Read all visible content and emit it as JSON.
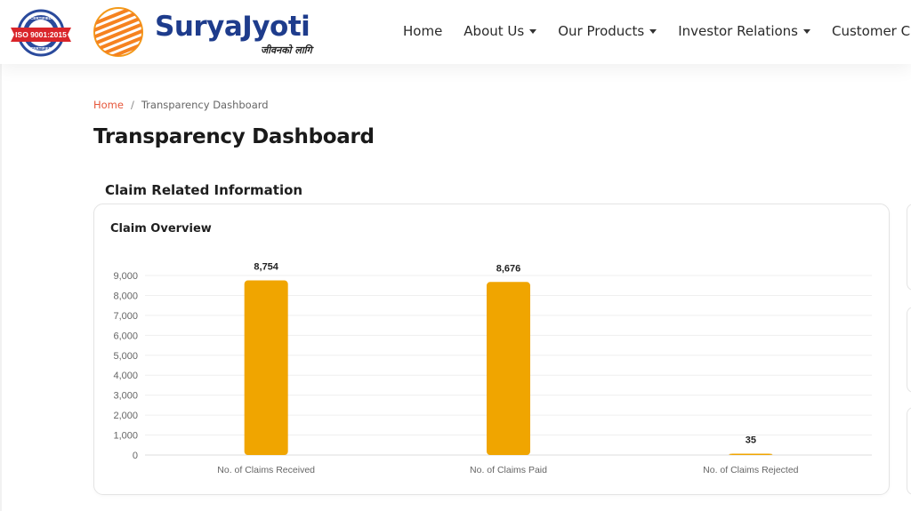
{
  "header": {
    "iso_badge": {
      "top_text": "CERTIFIED",
      "main_text": "ISO 9001:2015",
      "bottom_text": "CERTIFIED"
    },
    "brand_name": "SuryaJyoti",
    "tagline": "जीवनको लागि",
    "nav": [
      {
        "label": "Home",
        "has_dropdown": false
      },
      {
        "label": "About Us",
        "has_dropdown": true
      },
      {
        "label": "Our Products",
        "has_dropdown": true
      },
      {
        "label": "Investor Relations",
        "has_dropdown": true
      },
      {
        "label": "Customer Care",
        "has_dropdown": false
      }
    ]
  },
  "breadcrumb": {
    "home": "Home",
    "separator": "/",
    "current": "Transparency Dashboard"
  },
  "page_title": "Transparency Dashboard",
  "section_title": "Claim Related Information",
  "chart_title": "Claim Overview",
  "colors": {
    "bar": "#f0a500",
    "brand_blue": "#1e3c8c",
    "accent_red": "#e6563a"
  },
  "chart_data": {
    "type": "bar",
    "title": "Claim Overview",
    "categories": [
      "No. of Claims Received",
      "No. of Claims Paid",
      "No. of Claims Rejected"
    ],
    "values": [
      8754,
      8676,
      35
    ],
    "value_labels": [
      "8,754",
      "8,676",
      "35"
    ],
    "ylim": [
      0,
      9000
    ],
    "yticks": [
      0,
      1000,
      2000,
      3000,
      4000,
      5000,
      6000,
      7000,
      8000,
      9000
    ],
    "ytick_labels": [
      "0",
      "1,000",
      "2,000",
      "3,000",
      "4,000",
      "5,000",
      "6,000",
      "7,000",
      "8,000",
      "9,000"
    ],
    "grid": true,
    "xlabel": "",
    "ylabel": ""
  }
}
